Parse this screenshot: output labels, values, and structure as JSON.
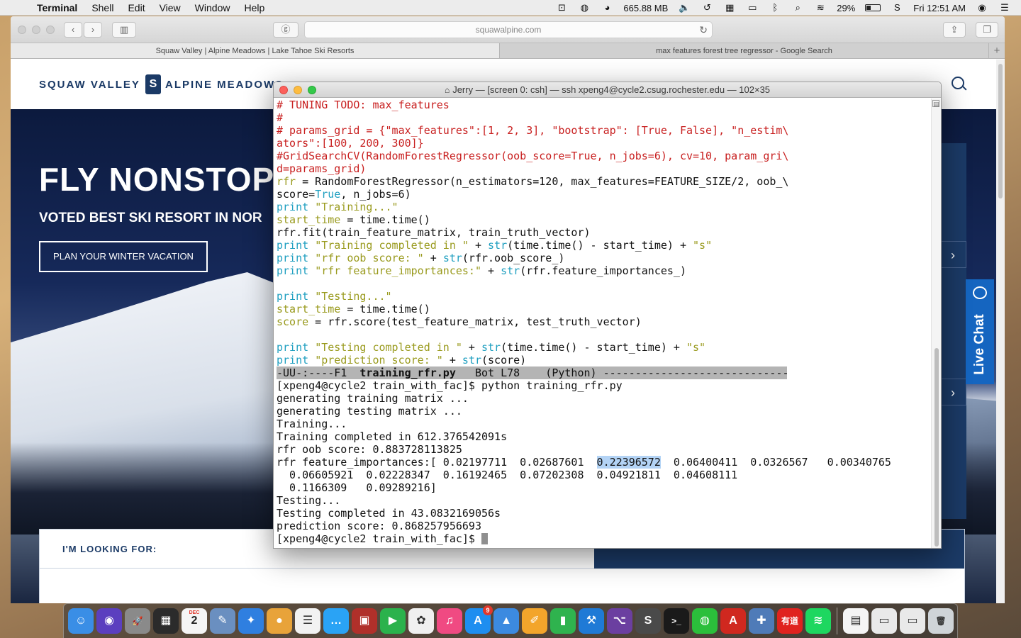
{
  "menubar": {
    "apple": "",
    "app_name": "Terminal",
    "menus": [
      "Shell",
      "Edit",
      "View",
      "Window",
      "Help"
    ],
    "memory": "665.88 MB",
    "battery": "29%",
    "battery_level": 0.29,
    "clock": "Fri 12:51 AM"
  },
  "safari": {
    "url": "squawalpine.com",
    "tabs": [
      {
        "title": "Squaw Valley | Alpine Meadows | Lake Tahoe Ski Resorts",
        "active": true
      },
      {
        "title": "max features forest tree regressor - Google Search",
        "active": false
      }
    ],
    "site": {
      "logo_left": "SQUAW VALLEY",
      "logo_right": "ALPINE MEADOWS",
      "hero_title": "FLY NONSTOP",
      "hero_subtitle": "VOTED BEST SKI RESORT IN NOR",
      "cta": "PLAN YOUR WINTER VACATION",
      "looking_for": "I'M LOOKING FOR:",
      "live_chat": "Live Chat"
    }
  },
  "terminal": {
    "title": "Jerry — [screen 0: csh] — ssh xpeng4@cycle2.csug.rochester.edu — 102×35",
    "lines": [
      {
        "segs": [
          {
            "t": "# TUNING TODO: max_features",
            "c": "red"
          }
        ]
      },
      {
        "segs": [
          {
            "t": "#",
            "c": "red"
          }
        ]
      },
      {
        "segs": [
          {
            "t": "# params_grid = {\"max_features\":[1, 2, 3], \"bootstrap\": [True, False], \"n_estim\\",
            "c": "red"
          }
        ]
      },
      {
        "segs": [
          {
            "t": "ators\":[100, 200, 300]}",
            "c": "red"
          }
        ]
      },
      {
        "segs": [
          {
            "t": "#GridSearchCV(RandomForestRegressor(oob_score=True, n_jobs=6), cv=10, param_gri\\",
            "c": "red"
          }
        ]
      },
      {
        "segs": [
          {
            "t": "d=params_grid)",
            "c": "red"
          }
        ]
      },
      {
        "segs": [
          {
            "t": "rfr",
            "c": "olive"
          },
          {
            "t": " = RandomForestRegressor(n_estimators=120, max_features=FEATURE_SIZE/2, oob_\\",
            "c": ""
          }
        ]
      },
      {
        "segs": [
          {
            "t": "score=",
            "c": ""
          },
          {
            "t": "True",
            "c": "cyan"
          },
          {
            "t": ", n_jobs=6)",
            "c": ""
          }
        ]
      },
      {
        "segs": [
          {
            "t": "print",
            "c": "cyan"
          },
          {
            "t": " ",
            "c": ""
          },
          {
            "t": "\"Training...\"",
            "c": "olive"
          }
        ]
      },
      {
        "segs": [
          {
            "t": "start_time",
            "c": "olive"
          },
          {
            "t": " = time.time()",
            "c": ""
          }
        ]
      },
      {
        "segs": [
          {
            "t": "rfr.fit(train_feature_matrix, train_truth_vector)",
            "c": ""
          }
        ]
      },
      {
        "segs": [
          {
            "t": "print",
            "c": "cyan"
          },
          {
            "t": " ",
            "c": ""
          },
          {
            "t": "\"Training completed in \"",
            "c": "olive"
          },
          {
            "t": " + ",
            "c": ""
          },
          {
            "t": "str",
            "c": "cyan"
          },
          {
            "t": "(time.time() - start_time) + ",
            "c": ""
          },
          {
            "t": "\"s\"",
            "c": "olive"
          }
        ]
      },
      {
        "segs": [
          {
            "t": "print",
            "c": "cyan"
          },
          {
            "t": " ",
            "c": ""
          },
          {
            "t": "\"rfr oob score: \"",
            "c": "olive"
          },
          {
            "t": " + ",
            "c": ""
          },
          {
            "t": "str",
            "c": "cyan"
          },
          {
            "t": "(rfr.oob_score_)",
            "c": ""
          }
        ]
      },
      {
        "segs": [
          {
            "t": "print",
            "c": "cyan"
          },
          {
            "t": " ",
            "c": ""
          },
          {
            "t": "\"rfr feature_importances:\"",
            "c": "olive"
          },
          {
            "t": " + ",
            "c": ""
          },
          {
            "t": "str",
            "c": "cyan"
          },
          {
            "t": "(rfr.feature_importances_)",
            "c": ""
          }
        ]
      },
      {
        "segs": [
          {
            "t": "",
            "c": ""
          }
        ]
      },
      {
        "segs": [
          {
            "t": "print",
            "c": "cyan"
          },
          {
            "t": " ",
            "c": ""
          },
          {
            "t": "\"Testing...\"",
            "c": "olive"
          }
        ]
      },
      {
        "segs": [
          {
            "t": "start_time",
            "c": "olive"
          },
          {
            "t": " = time.time()",
            "c": ""
          }
        ]
      },
      {
        "segs": [
          {
            "t": "score",
            "c": "olive"
          },
          {
            "t": " = rfr.score(test_feature_matrix, test_truth_vector)",
            "c": ""
          }
        ]
      },
      {
        "segs": [
          {
            "t": "",
            "c": ""
          }
        ]
      },
      {
        "segs": [
          {
            "t": "print",
            "c": "cyan"
          },
          {
            "t": " ",
            "c": ""
          },
          {
            "t": "\"Testing completed in \"",
            "c": "olive"
          },
          {
            "t": " + ",
            "c": ""
          },
          {
            "t": "str",
            "c": "cyan"
          },
          {
            "t": "(time.time() - start_time) + ",
            "c": ""
          },
          {
            "t": "\"s\"",
            "c": "olive"
          }
        ]
      },
      {
        "segs": [
          {
            "t": "print",
            "c": "cyan"
          },
          {
            "t": " ",
            "c": ""
          },
          {
            "t": "\"prediction score: \"",
            "c": "olive"
          },
          {
            "t": " + ",
            "c": ""
          },
          {
            "t": "str",
            "c": "cyan"
          },
          {
            "t": "(score)",
            "c": ""
          }
        ]
      },
      {
        "kind": "modeline",
        "segs": [
          {
            "t": "-UU-:----F1  ",
            "c": ""
          },
          {
            "t": "training_rfr.py",
            "c": "bold"
          },
          {
            "t": "   Bot L78    (Python) ------------------------------",
            "c": ""
          }
        ]
      },
      {
        "segs": [
          {
            "t": "[xpeng4@cycle2 train_with_fac]$ python training_rfr.py",
            "c": ""
          }
        ]
      },
      {
        "segs": [
          {
            "t": "generating training matrix ...",
            "c": ""
          }
        ]
      },
      {
        "segs": [
          {
            "t": "generating testing matrix ...",
            "c": ""
          }
        ]
      },
      {
        "segs": [
          {
            "t": "Training...",
            "c": ""
          }
        ]
      },
      {
        "segs": [
          {
            "t": "Training completed in 612.376542091s",
            "c": ""
          }
        ]
      },
      {
        "segs": [
          {
            "t": "rfr oob score: 0.883728113825",
            "c": ""
          }
        ]
      },
      {
        "segs": [
          {
            "t": "rfr feature_importances:[ 0.02197711  0.02687601  ",
            "c": ""
          },
          {
            "t": "0.22396572",
            "c": "sel"
          },
          {
            "t": "  0.06400411  0.0326567   0.00340765",
            "c": ""
          }
        ]
      },
      {
        "segs": [
          {
            "t": "  0.06605921  0.02228347  0.16192465  0.07202308  0.04921811  0.04608111",
            "c": ""
          }
        ]
      },
      {
        "segs": [
          {
            "t": "  0.1166309   0.09289216]",
            "c": ""
          }
        ]
      },
      {
        "segs": [
          {
            "t": "Testing...",
            "c": ""
          }
        ]
      },
      {
        "segs": [
          {
            "t": "Testing completed in 43.0832169056s",
            "c": ""
          }
        ]
      },
      {
        "segs": [
          {
            "t": "prediction score: 0.868257956693",
            "c": ""
          }
        ]
      },
      {
        "kind": "prompt",
        "segs": [
          {
            "t": "[xpeng4@cycle2 train_with_fac]$ ",
            "c": ""
          }
        ]
      }
    ]
  },
  "dock": {
    "apps": [
      {
        "name": "finder",
        "glyph": "☺",
        "color": "#3a8ee6"
      },
      {
        "name": "siri",
        "glyph": "◉",
        "color": "#5b3fbf"
      },
      {
        "name": "launchpad",
        "glyph": "🚀",
        "color": "#8a8a8a"
      },
      {
        "name": "activity-monitor",
        "glyph": "▦",
        "color": "#2b2b2b"
      },
      {
        "name": "calendar",
        "glyph": "2",
        "color": "#f5f5f5",
        "label": "DEC"
      },
      {
        "name": "preview",
        "glyph": "✎",
        "color": "#6a8fc0"
      },
      {
        "name": "safari",
        "glyph": "✦",
        "color": "#2f7fe0"
      },
      {
        "name": "chrome",
        "glyph": "●",
        "color": "#e8a33a"
      },
      {
        "name": "notes",
        "glyph": "☰",
        "color": "#f2f2f2"
      },
      {
        "name": "messages",
        "glyph": "…",
        "color": "#2aa3f5"
      },
      {
        "name": "photo-booth",
        "glyph": "▣",
        "color": "#b0302a"
      },
      {
        "name": "facetime",
        "glyph": "▶",
        "color": "#2bb24c"
      },
      {
        "name": "photos",
        "glyph": "✿",
        "color": "#f0f0f0"
      },
      {
        "name": "itunes",
        "glyph": "♫",
        "color": "#f04a82"
      },
      {
        "name": "app-store",
        "glyph": "A",
        "color": "#1e8ef0",
        "badge": "9"
      },
      {
        "name": "keynote",
        "glyph": "▲",
        "color": "#3c8ae0"
      },
      {
        "name": "pages",
        "glyph": "✐",
        "color": "#f3a52b"
      },
      {
        "name": "numbers",
        "glyph": "▮",
        "color": "#2fb34e"
      },
      {
        "name": "xcode",
        "glyph": "⚒",
        "color": "#1f7ad6"
      },
      {
        "name": "github-desktop",
        "glyph": "⌥",
        "color": "#6b3fa0"
      },
      {
        "name": "sublime-text",
        "glyph": "S",
        "color": "#4a4a4a"
      },
      {
        "name": "terminal",
        "glyph": ">_",
        "color": "#1a1a1a"
      },
      {
        "name": "wechat",
        "glyph": "◍",
        "color": "#2bbf3b"
      },
      {
        "name": "acrobat",
        "glyph": "A",
        "color": "#d0281f"
      },
      {
        "name": "tableau",
        "glyph": "✚",
        "color": "#4f7bb8"
      },
      {
        "name": "youdao",
        "glyph": "有道",
        "color": "#e0231f"
      },
      {
        "name": "spotify",
        "glyph": "≋",
        "color": "#1ed760"
      }
    ],
    "docs": [
      {
        "name": "document-stack",
        "glyph": "▤",
        "color": "#f5f5f5"
      },
      {
        "name": "downloads-stack",
        "glyph": "▭",
        "color": "#e9e9e9"
      },
      {
        "name": "pdf-stack",
        "glyph": "▭",
        "color": "#e9e9e9"
      },
      {
        "name": "trash",
        "glyph": "🗑",
        "color": "#cfd4d8"
      }
    ]
  }
}
